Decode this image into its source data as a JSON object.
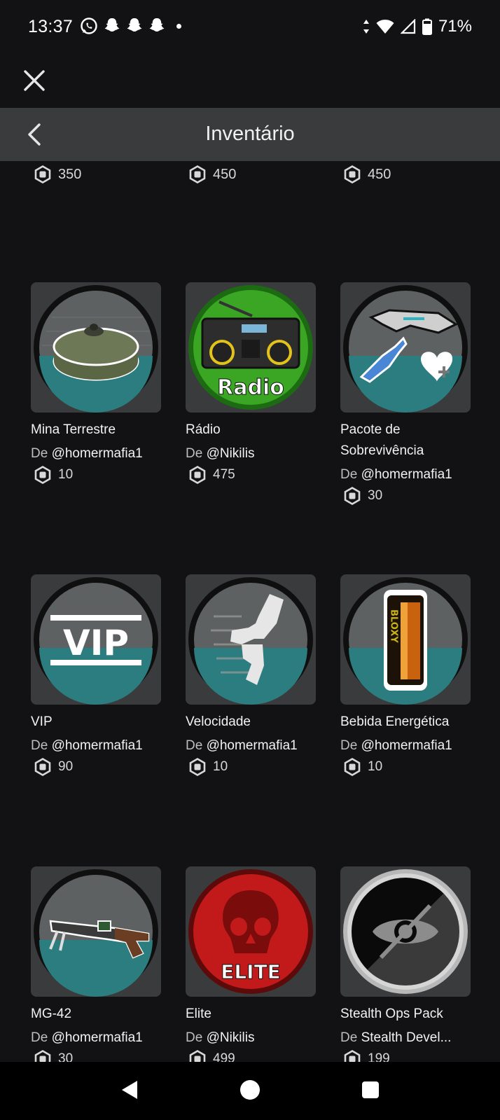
{
  "status_bar": {
    "time": "13:37",
    "battery": "71%"
  },
  "header": {
    "title": "Inventário"
  },
  "top_prices": [
    "350",
    "450",
    "450"
  ],
  "creator_prefix": "De",
  "items": [
    {
      "name": "Mina Terrestre",
      "creator": "@homermafia1",
      "price": "10",
      "icon": "landmine-icon"
    },
    {
      "name": "Rádio",
      "creator": "@Nikilis",
      "price": "475",
      "icon": "radio-icon",
      "label": "Radio"
    },
    {
      "name": "Pacote de Sobrevivência",
      "creator": "@homermafia1",
      "price": "30",
      "icon": "survival-pack-icon"
    },
    {
      "name": "VIP",
      "creator": "@homermafia1",
      "price": "90",
      "icon": "vip-icon",
      "label": "VIP"
    },
    {
      "name": "Velocidade",
      "creator": "@homermafia1",
      "price": "10",
      "icon": "speed-icon"
    },
    {
      "name": "Bebida Energética",
      "creator": "@homermafia1",
      "price": "10",
      "icon": "energy-drink-icon",
      "label": "BLOXY"
    },
    {
      "name": "MG-42",
      "creator": "@homermafia1",
      "price": "30",
      "icon": "machine-gun-icon"
    },
    {
      "name": "Elite",
      "creator": "@Nikilis",
      "price": "499",
      "icon": "elite-skull-icon",
      "label": "ELITE"
    },
    {
      "name": "Stealth Ops Pack",
      "creator": "Stealth Devel...",
      "price": "199",
      "icon": "stealth-eye-icon"
    }
  ],
  "colors": {
    "background": "#121215",
    "header": "#393b3d",
    "card": "#393b3d",
    "teal": "#2f8a8c",
    "radio_green": "#39a823",
    "elite_red": "#c21a1a"
  }
}
